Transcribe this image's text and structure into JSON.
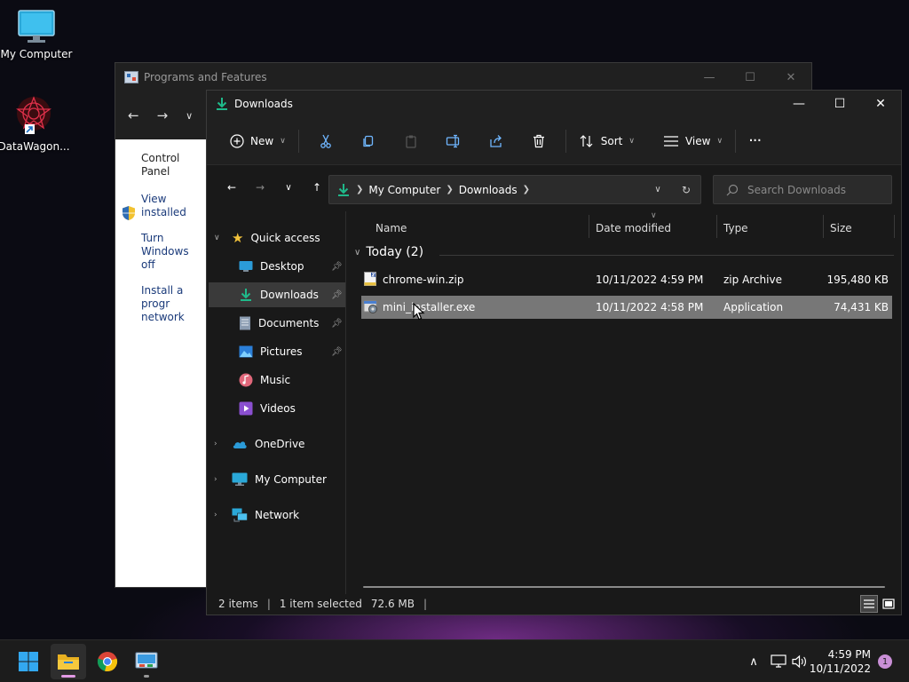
{
  "desktop": {
    "icons": [
      {
        "label": "My Computer",
        "icon": "monitor-icon"
      },
      {
        "label": "DataWagon...",
        "icon": "datawagon-logo-icon"
      }
    ]
  },
  "programs_window": {
    "title": "Programs and Features",
    "side_links": {
      "control_panel": "Control Panel",
      "view_installed": "View installed",
      "turn_windows": "Turn Windows",
      "turn_windows_2": "off",
      "install_program": "Install a progr",
      "install_program_2": "network"
    }
  },
  "explorer": {
    "title": "Downloads",
    "toolbar": {
      "new_label": "New",
      "sort_label": "Sort",
      "view_label": "View",
      "more_label": "···"
    },
    "address": {
      "crumbs": [
        "My Computer",
        "Downloads"
      ]
    },
    "search": {
      "placeholder": "Search Downloads"
    },
    "nav": {
      "quick_access": "Quick access",
      "items": [
        "Desktop",
        "Downloads",
        "Documents",
        "Pictures",
        "Music",
        "Videos"
      ],
      "onedrive": "OneDrive",
      "my_computer": "My Computer",
      "network": "Network"
    },
    "columns": {
      "name": "Name",
      "date": "Date modified",
      "type": "Type",
      "size": "Size"
    },
    "group": {
      "label": "Today (2)"
    },
    "files": [
      {
        "name": "chrome-win.zip",
        "date": "10/11/2022 4:59 PM",
        "type": "zip Archive",
        "size": "195,480 KB"
      },
      {
        "name": "mini_installer.exe",
        "date": "10/11/2022 4:58 PM",
        "type": "Application",
        "size": "74,431 KB"
      }
    ],
    "status": {
      "items": "2 items",
      "selected": "1 item selected",
      "selected_size": "72.6 MB"
    }
  },
  "taskbar": {
    "time": "4:59 PM",
    "date": "10/11/2022",
    "notifications": "1"
  },
  "colors": {
    "accent_green": "#1fb98a",
    "selection": "#777777",
    "taskbar": "#1c1c1c"
  }
}
